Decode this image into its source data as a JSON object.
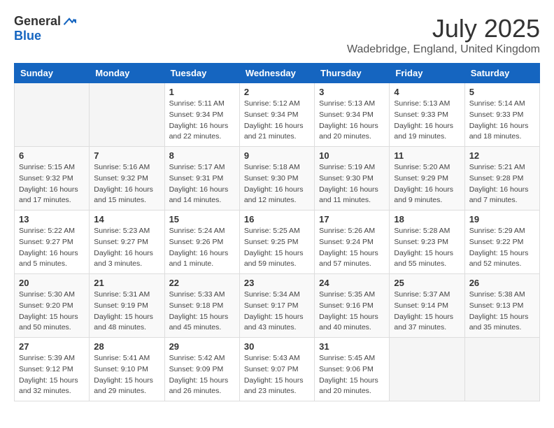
{
  "logo": {
    "general": "General",
    "blue": "Blue"
  },
  "header": {
    "month": "July 2025",
    "location": "Wadebridge, England, United Kingdom"
  },
  "weekdays": [
    "Sunday",
    "Monday",
    "Tuesday",
    "Wednesday",
    "Thursday",
    "Friday",
    "Saturday"
  ],
  "weeks": [
    [
      {
        "day": "",
        "sunrise": "",
        "sunset": "",
        "daylight": ""
      },
      {
        "day": "",
        "sunrise": "",
        "sunset": "",
        "daylight": ""
      },
      {
        "day": "1",
        "sunrise": "Sunrise: 5:11 AM",
        "sunset": "Sunset: 9:34 PM",
        "daylight": "Daylight: 16 hours and 22 minutes."
      },
      {
        "day": "2",
        "sunrise": "Sunrise: 5:12 AM",
        "sunset": "Sunset: 9:34 PM",
        "daylight": "Daylight: 16 hours and 21 minutes."
      },
      {
        "day": "3",
        "sunrise": "Sunrise: 5:13 AM",
        "sunset": "Sunset: 9:34 PM",
        "daylight": "Daylight: 16 hours and 20 minutes."
      },
      {
        "day": "4",
        "sunrise": "Sunrise: 5:13 AM",
        "sunset": "Sunset: 9:33 PM",
        "daylight": "Daylight: 16 hours and 19 minutes."
      },
      {
        "day": "5",
        "sunrise": "Sunrise: 5:14 AM",
        "sunset": "Sunset: 9:33 PM",
        "daylight": "Daylight: 16 hours and 18 minutes."
      }
    ],
    [
      {
        "day": "6",
        "sunrise": "Sunrise: 5:15 AM",
        "sunset": "Sunset: 9:32 PM",
        "daylight": "Daylight: 16 hours and 17 minutes."
      },
      {
        "day": "7",
        "sunrise": "Sunrise: 5:16 AM",
        "sunset": "Sunset: 9:32 PM",
        "daylight": "Daylight: 16 hours and 15 minutes."
      },
      {
        "day": "8",
        "sunrise": "Sunrise: 5:17 AM",
        "sunset": "Sunset: 9:31 PM",
        "daylight": "Daylight: 16 hours and 14 minutes."
      },
      {
        "day": "9",
        "sunrise": "Sunrise: 5:18 AM",
        "sunset": "Sunset: 9:30 PM",
        "daylight": "Daylight: 16 hours and 12 minutes."
      },
      {
        "day": "10",
        "sunrise": "Sunrise: 5:19 AM",
        "sunset": "Sunset: 9:30 PM",
        "daylight": "Daylight: 16 hours and 11 minutes."
      },
      {
        "day": "11",
        "sunrise": "Sunrise: 5:20 AM",
        "sunset": "Sunset: 9:29 PM",
        "daylight": "Daylight: 16 hours and 9 minutes."
      },
      {
        "day": "12",
        "sunrise": "Sunrise: 5:21 AM",
        "sunset": "Sunset: 9:28 PM",
        "daylight": "Daylight: 16 hours and 7 minutes."
      }
    ],
    [
      {
        "day": "13",
        "sunrise": "Sunrise: 5:22 AM",
        "sunset": "Sunset: 9:27 PM",
        "daylight": "Daylight: 16 hours and 5 minutes."
      },
      {
        "day": "14",
        "sunrise": "Sunrise: 5:23 AM",
        "sunset": "Sunset: 9:27 PM",
        "daylight": "Daylight: 16 hours and 3 minutes."
      },
      {
        "day": "15",
        "sunrise": "Sunrise: 5:24 AM",
        "sunset": "Sunset: 9:26 PM",
        "daylight": "Daylight: 16 hours and 1 minute."
      },
      {
        "day": "16",
        "sunrise": "Sunrise: 5:25 AM",
        "sunset": "Sunset: 9:25 PM",
        "daylight": "Daylight: 15 hours and 59 minutes."
      },
      {
        "day": "17",
        "sunrise": "Sunrise: 5:26 AM",
        "sunset": "Sunset: 9:24 PM",
        "daylight": "Daylight: 15 hours and 57 minutes."
      },
      {
        "day": "18",
        "sunrise": "Sunrise: 5:28 AM",
        "sunset": "Sunset: 9:23 PM",
        "daylight": "Daylight: 15 hours and 55 minutes."
      },
      {
        "day": "19",
        "sunrise": "Sunrise: 5:29 AM",
        "sunset": "Sunset: 9:22 PM",
        "daylight": "Daylight: 15 hours and 52 minutes."
      }
    ],
    [
      {
        "day": "20",
        "sunrise": "Sunrise: 5:30 AM",
        "sunset": "Sunset: 9:20 PM",
        "daylight": "Daylight: 15 hours and 50 minutes."
      },
      {
        "day": "21",
        "sunrise": "Sunrise: 5:31 AM",
        "sunset": "Sunset: 9:19 PM",
        "daylight": "Daylight: 15 hours and 48 minutes."
      },
      {
        "day": "22",
        "sunrise": "Sunrise: 5:33 AM",
        "sunset": "Sunset: 9:18 PM",
        "daylight": "Daylight: 15 hours and 45 minutes."
      },
      {
        "day": "23",
        "sunrise": "Sunrise: 5:34 AM",
        "sunset": "Sunset: 9:17 PM",
        "daylight": "Daylight: 15 hours and 43 minutes."
      },
      {
        "day": "24",
        "sunrise": "Sunrise: 5:35 AM",
        "sunset": "Sunset: 9:16 PM",
        "daylight": "Daylight: 15 hours and 40 minutes."
      },
      {
        "day": "25",
        "sunrise": "Sunrise: 5:37 AM",
        "sunset": "Sunset: 9:14 PM",
        "daylight": "Daylight: 15 hours and 37 minutes."
      },
      {
        "day": "26",
        "sunrise": "Sunrise: 5:38 AM",
        "sunset": "Sunset: 9:13 PM",
        "daylight": "Daylight: 15 hours and 35 minutes."
      }
    ],
    [
      {
        "day": "27",
        "sunrise": "Sunrise: 5:39 AM",
        "sunset": "Sunset: 9:12 PM",
        "daylight": "Daylight: 15 hours and 32 minutes."
      },
      {
        "day": "28",
        "sunrise": "Sunrise: 5:41 AM",
        "sunset": "Sunset: 9:10 PM",
        "daylight": "Daylight: 15 hours and 29 minutes."
      },
      {
        "day": "29",
        "sunrise": "Sunrise: 5:42 AM",
        "sunset": "Sunset: 9:09 PM",
        "daylight": "Daylight: 15 hours and 26 minutes."
      },
      {
        "day": "30",
        "sunrise": "Sunrise: 5:43 AM",
        "sunset": "Sunset: 9:07 PM",
        "daylight": "Daylight: 15 hours and 23 minutes."
      },
      {
        "day": "31",
        "sunrise": "Sunrise: 5:45 AM",
        "sunset": "Sunset: 9:06 PM",
        "daylight": "Daylight: 15 hours and 20 minutes."
      },
      {
        "day": "",
        "sunrise": "",
        "sunset": "",
        "daylight": ""
      },
      {
        "day": "",
        "sunrise": "",
        "sunset": "",
        "daylight": ""
      }
    ]
  ]
}
